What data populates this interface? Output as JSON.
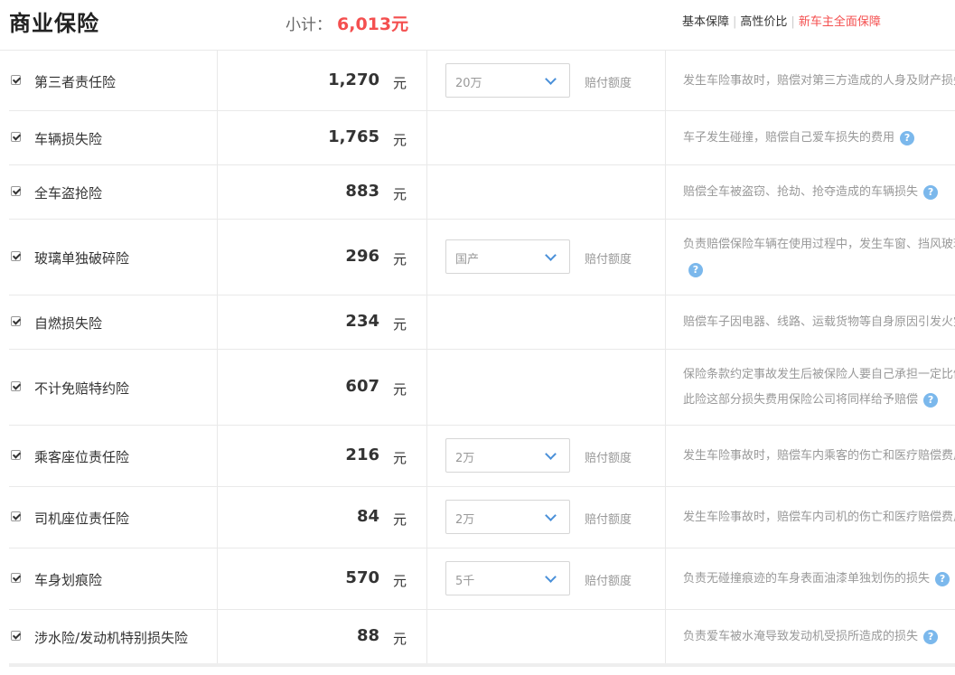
{
  "header": {
    "title": "商业保险",
    "subtotal_label": "小计：",
    "subtotal_amount": "6,013元",
    "plans": [
      "基本保障",
      "高性价比",
      "新车主全面保障"
    ]
  },
  "rows": [
    {
      "name": "第三者责任险",
      "price": "1,270",
      "unit": "元",
      "select": "20万",
      "coverage": "赔付额度",
      "desc": [
        "发生车险事故时，赔偿对第三方造成的人身及财产损失"
      ]
    },
    {
      "name": "车辆损失险",
      "price": "1,765",
      "unit": "元",
      "select": "",
      "coverage": "",
      "desc": [
        "车子发生碰撞，赔偿自己爱车损失的费用"
      ]
    },
    {
      "name": "全车盗抢险",
      "price": "883",
      "unit": "元",
      "select": "",
      "coverage": "",
      "desc": [
        "赔偿全车被盗窃、抢劫、抢夺造成的车辆损失"
      ]
    },
    {
      "name": "玻璃单独破碎险",
      "price": "296",
      "unit": "元",
      "select": "国产",
      "coverage": "赔付额度",
      "desc": [
        "负责赔偿保险车辆在使用过程中，发生车窗、挡风玻璃单独破碎的损失",
        ""
      ]
    },
    {
      "name": "自燃损失险",
      "price": "234",
      "unit": "元",
      "select": "",
      "coverage": "",
      "desc": [
        "赔偿车子因电器、线路、运载货物等自身原因引发火灾的损失"
      ]
    },
    {
      "name": "不计免赔特约险",
      "price": "607",
      "unit": "元",
      "select": "",
      "coverage": "",
      "desc": [
        "保险条款约定事故发生后被保险人要自己承担一定比例的损失，",
        "此险这部分损失费用保险公司将同样给予赔偿"
      ]
    },
    {
      "name": "乘客座位责任险",
      "price": "216",
      "unit": "元",
      "select": "2万",
      "coverage": "赔付额度",
      "desc": [
        "发生车险事故时，赔偿车内乘客的伤亡和医疗赔偿费用"
      ]
    },
    {
      "name": "司机座位责任险",
      "price": "84",
      "unit": "元",
      "select": "2万",
      "coverage": "赔付额度",
      "desc": [
        "发生车险事故时，赔偿车内司机的伤亡和医疗赔偿费用"
      ]
    },
    {
      "name": "车身划痕险",
      "price": "570",
      "unit": "元",
      "select": "5千",
      "coverage": "赔付额度",
      "desc": [
        "负责无碰撞痕迹的车身表面油漆单独划伤的损失"
      ]
    },
    {
      "name": "涉水险/发动机特别损失险",
      "price": "88",
      "unit": "元",
      "select": "",
      "coverage": "",
      "desc": [
        "负责爱车被水淹导致发动机受损所造成的损失"
      ]
    }
  ],
  "icons": {
    "help": "question-icon",
    "checkbox": "checkmark-icon",
    "dropdown": "chevron-down-icon"
  },
  "colors": {
    "accent_red": "#f44f4f",
    "help_blue": "#7bb8ec",
    "chevron_blue": "#4a90d9"
  }
}
